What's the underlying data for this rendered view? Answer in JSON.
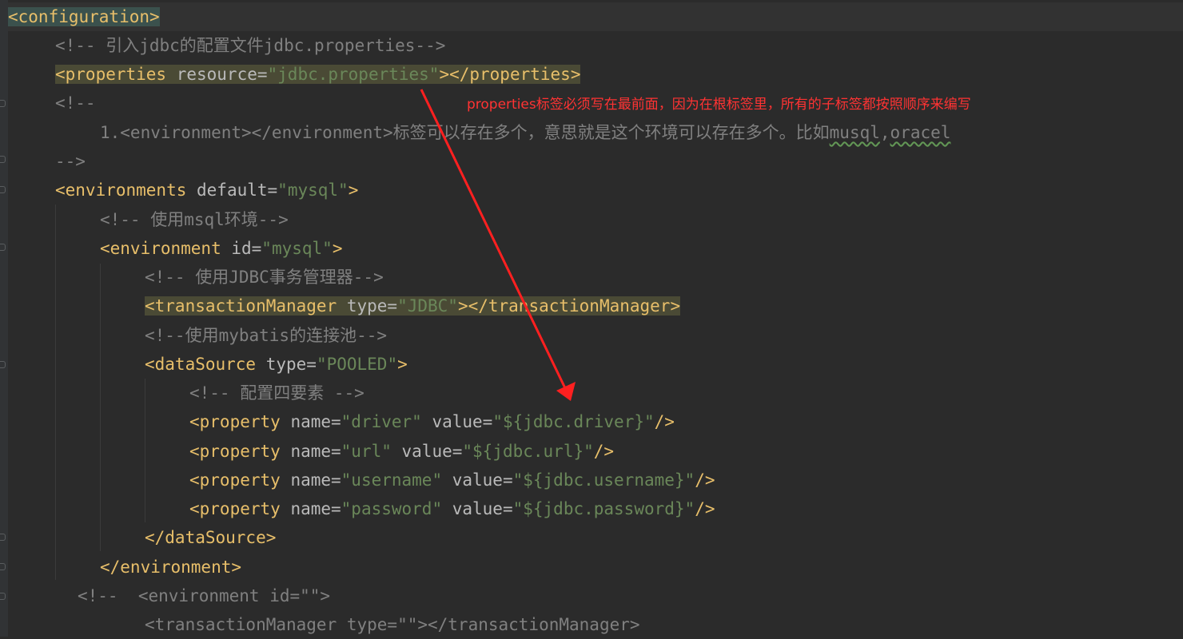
{
  "annotation": {
    "text": "properties标签必须写在最前面，因为在根标签里，所有的子标签都按照顺序来编写",
    "color": "#ff3333"
  },
  "colors": {
    "background": "#2b2b2b",
    "tag": "#e8bf6a",
    "attribute": "#bababa",
    "string": "#6a8759",
    "comment": "#808080"
  },
  "code": {
    "l1_tag": "<configuration>",
    "l2_comment": "<!-- 引入jdbc的配置文件jdbc.properties-->",
    "l3_open": "<properties",
    "l3_attr": " resource=",
    "l3_val": "\"jdbc.properties\"",
    "l3_close": "></properties>",
    "l4_comment": "<!--",
    "l5_a": "1.<environment></environment>标签可以存在多个，意思就是这个环境可以存在多个。比如",
    "l5_b": "musql",
    "l5_c": ",",
    "l5_d": "oracel",
    "l6_comment": "-->",
    "l7_open": "<environments",
    "l7_attr": " default=",
    "l7_val": "\"mysql\"",
    "l7_close": ">",
    "l8_comment": "<!-- 使用msql环境-->",
    "l9_open": "<environment",
    "l9_attr": " id=",
    "l9_val": "\"mysql\"",
    "l9_close": ">",
    "l10_comment": "<!-- 使用JDBC事务管理器-->",
    "l11_open": "<transactionManager",
    "l11_attr": " type=",
    "l11_val": "\"JDBC\"",
    "l11_close": "></transactionManager>",
    "l12_comment": "<!--使用mybatis的连接池-->",
    "l13_open": "<dataSource",
    "l13_attr": " type=",
    "l13_val": "\"POOLED\"",
    "l13_close": ">",
    "l14_comment": "<!-- 配置四要素 -->",
    "prop_open": "<property",
    "name_attr": " name=",
    "value_attr": " value=",
    "self_close": "/>",
    "p1_name": "\"driver\"",
    "p1_value": "\"${jdbc.driver}\"",
    "p2_name": "\"url\"",
    "p2_value": "\"${jdbc.url}\"",
    "p3_name": "\"username\"",
    "p3_value": "\"${jdbc.username}\"",
    "p4_name": "\"password\"",
    "p4_value": "\"${jdbc.password}\"",
    "l19_tag": "</dataSource>",
    "l20_tag": "</environment>",
    "l21_comment": "<!--  <environment id=\"\">",
    "l22_comment": "<transactionManager type=\"\"></transactionManager>"
  }
}
